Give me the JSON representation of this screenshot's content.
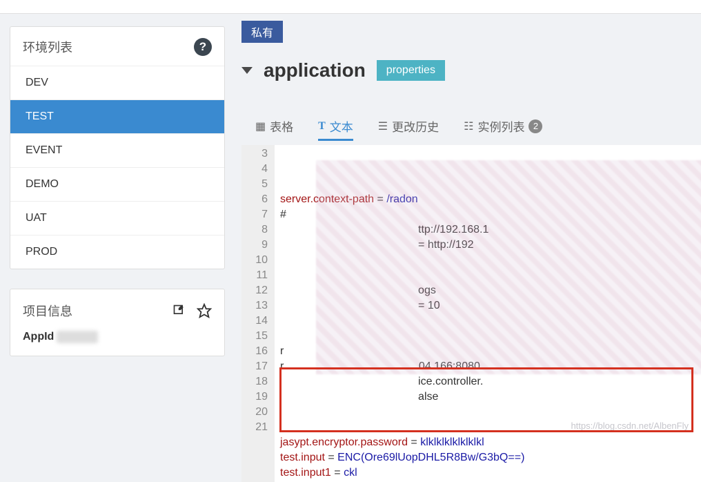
{
  "sidebar": {
    "env_title": "环境列表",
    "items": [
      {
        "label": "DEV"
      },
      {
        "label": "TEST"
      },
      {
        "label": "EVENT"
      },
      {
        "label": "DEMO"
      },
      {
        "label": "UAT"
      },
      {
        "label": "PROD"
      }
    ],
    "active_index": 1,
    "project_title": "项目信息",
    "appid_label": "AppId"
  },
  "main": {
    "private_tag": "私有",
    "title": "application",
    "badge": "properties",
    "tabs": {
      "table": "表格",
      "text": "文本",
      "history": "更改历史",
      "instances": "实例列表",
      "instances_count": "2"
    }
  },
  "editor": {
    "lines": [
      {
        "n": "3",
        "key": "server.context-path",
        "val": "/radon"
      },
      {
        "n": "4",
        "raw": "#"
      },
      {
        "n": "5",
        "raw": "                                             ttp://192.168.1"
      },
      {
        "n": "6",
        "raw": "                                             = http://192"
      },
      {
        "n": "7",
        "raw": ""
      },
      {
        "n": "8",
        "raw": ""
      },
      {
        "n": "9",
        "raw": "                                             ogs"
      },
      {
        "n": "10",
        "raw": "                                             = 10"
      },
      {
        "n": "11",
        "raw": ""
      },
      {
        "n": "12",
        "raw": ""
      },
      {
        "n": "13",
        "raw": "r"
      },
      {
        "n": "14",
        "raw": "r                                            04.166:8080"
      },
      {
        "n": "15",
        "raw": "                                             ice.controller."
      },
      {
        "n": "16",
        "raw": "                                             alse"
      },
      {
        "n": "17",
        "raw": ""
      },
      {
        "n": "18",
        "raw": ""
      },
      {
        "n": "19",
        "key": "jasypt.encryptor.password",
        "val": "klklklklklklklkl"
      },
      {
        "n": "20",
        "key": "test.input",
        "val": "ENC(Ore69lUopDHL5R8Bw/G3bQ==)"
      },
      {
        "n": "21",
        "key": "test.input1",
        "val": "ckl"
      }
    ]
  },
  "watermark": "https://blog.csdn.net/AlbenFly"
}
